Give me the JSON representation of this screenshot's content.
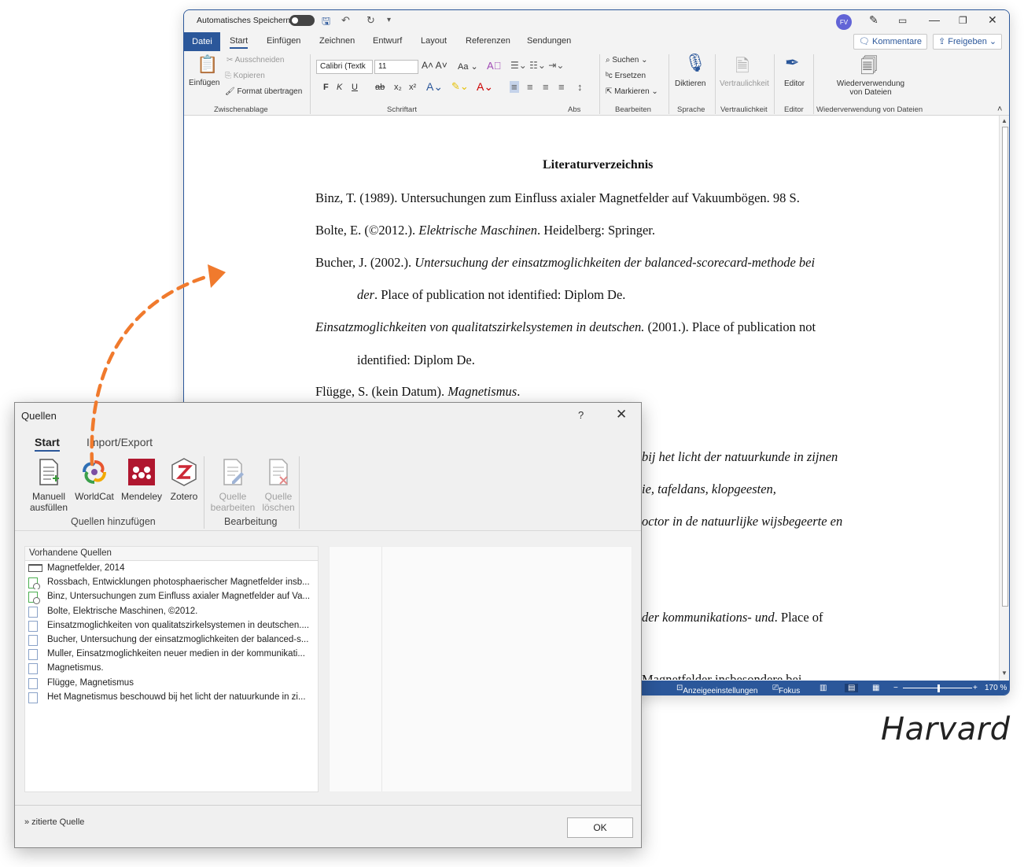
{
  "word": {
    "autosave_label": "Automatisches Speichern",
    "avatar_initials": "FV",
    "menu": {
      "file": "Datei",
      "tabs": [
        "Start",
        "Einfügen",
        "Zeichnen",
        "Entwurf",
        "Layout",
        "Referenzen",
        "Sendungen"
      ],
      "comments": "Kommentare",
      "share": "Freigeben"
    },
    "ribbon": {
      "paste": "Einfügen",
      "cut": "Ausschneiden",
      "copy": "Kopieren",
      "format_painter": "Format übertragen",
      "group_clipboard": "Zwischenablage",
      "font_name": "Calibri (Textk",
      "font_size": "11",
      "bold": "F",
      "italic": "K",
      "underline": "U",
      "strike": "ab",
      "sub": "x",
      "sup": "x",
      "group_font": "Schriftart",
      "group_paragraph": "Abs",
      "search": "Suchen",
      "replace": "Ersetzen",
      "select": "Markieren",
      "group_edit": "Bearbeiten",
      "dictate": "Diktieren",
      "group_voice": "Sprache",
      "sensitivity": "Vertraulichkeit",
      "group_sensitivity": "Vertraulichkeit",
      "editor": "Editor",
      "group_editor": "Editor",
      "reuse_line1": "Wiederverwendung",
      "reuse_line2": "von Dateien",
      "group_reuse": "Wiederverwendung von Dateien"
    },
    "document": {
      "title": "Literaturverzeichnis",
      "lines": {
        "l1": "Binz, T. (1989). Untersuchungen zum Einfluss axialer Magnetfelder auf Vakuumbögen. 98 S.",
        "l2a": "Bolte, E. (©2012.). ",
        "l2b": "Elektrische Maschinen",
        "l2c": ". Heidelberg: Springer.",
        "l3a": "Bucher, J. (2002.). ",
        "l3b": "Untersuchung der einsatzmoglichkeiten der balanced-scorecard-methode bei",
        "l4a": "der",
        "l4b": ". Place of publication not identified: Diplom De.",
        "l5a": "Einsatzmoglichkeiten von qualitatszirkelsystemen in deutschen.",
        "l5b": " (2001.). Place of publication not",
        "l6": "identified: Diplom De.",
        "l7a": "Flügge, S. (kein Datum). ",
        "l7b": "Magnetismus",
        "l7c": ".",
        "l8": "bij het licht der natuurkunde in zijnen",
        "l9": "ie, tafeldans, klopgeesten,",
        "l10": "octor in de natuurlijke wijsbegeerte en",
        "l11a": "der kommunikations- und",
        "l11b": ". Place of",
        "l12": "Magnetfelder insbesondere bei"
      }
    },
    "status": {
      "display_settings": "Anzeigeeinstellungen",
      "focus": "Fokus",
      "zoom": "170 %"
    }
  },
  "dialog": {
    "title": "Quellen",
    "help": "?",
    "close": "✕",
    "tabs": [
      "Start",
      "Import/Export"
    ],
    "buttons": {
      "manual_1": "Manuell",
      "manual_2": "ausfüllen",
      "worldcat": "WorldCat",
      "mendeley": "Mendeley",
      "zotero": "Zotero",
      "edit_1": "Quelle",
      "edit_2": "bearbeiten",
      "delete_1": "Quelle",
      "delete_2": "löschen"
    },
    "group_add": "Quellen hinzufügen",
    "group_edit": "Bearbeitung",
    "list_header": "Vorhandene Quellen",
    "sources": [
      "Magnetfelder, 2014",
      "Rossbach, Entwicklungen photosphaerischer Magnetfelder insb...",
      "Binz, Untersuchungen zum Einfluss axialer Magnetfelder auf Va...",
      "Bolte, Elektrische Maschinen, ©2012.",
      "Einsatzmoglichkeiten von qualitatszirkelsystemen in deutschen....",
      "Bucher, Untersuchung der einsatzmoglichkeiten der balanced-s...",
      "Muller, Einsatzmoglichkeiten neuer medien in der kommunikati...",
      "Magnetismus.",
      "Flügge, Magnetismus",
      "Het Magnetismus beschouwd bij het licht der natuurkunde in zi..."
    ],
    "cited": "» zitierte Quelle",
    "ok": "OK"
  },
  "caption": "Harvard",
  "colors": {
    "accent": "#2b579a",
    "arrow": "#f07a2d"
  }
}
